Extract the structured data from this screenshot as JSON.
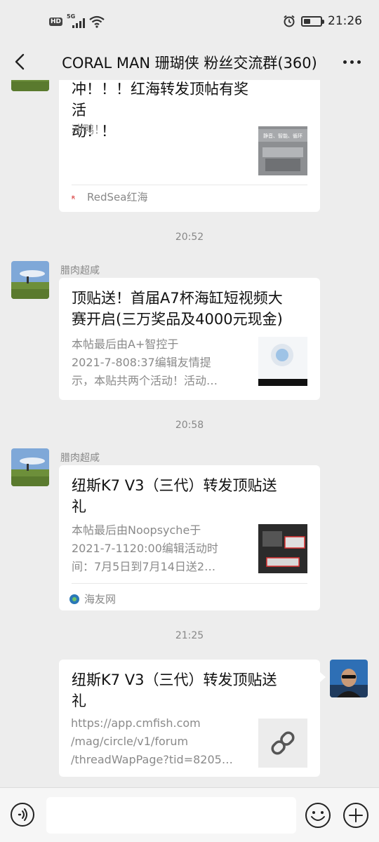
{
  "status_bar": {
    "hd": "HD",
    "network": "5G",
    "time": "21:26"
  },
  "nav": {
    "title": "CORAL MAN 珊瑚侠 粉丝交流群(360)"
  },
  "messages": [
    {
      "title_lines": [
        "冲！！！红海转发顶帖有奖活",
        "动！！"
      ],
      "desc_lines": [
        "冲鸭！"
      ],
      "thumb_caption": "静音、智能、循环",
      "source": "RedSea红海"
    },
    {
      "time": "20:52",
      "sender": "腊肉超咸",
      "title_lines": [
        "顶贴送！首届A7杯海缸短视频大",
        "赛开启(三万奖品及4000元现金)"
      ],
      "desc_lines": [
        "本帖最后由A+智控于",
        "2021-7-808:37编辑友情提",
        "示，本贴共两个活动！活动…"
      ]
    },
    {
      "time": "20:58",
      "sender": "腊肉超咸",
      "title_lines": [
        "纽斯K7 V3（三代）转发顶贴送",
        "礼"
      ],
      "desc_lines": [
        "本帖最后由Noopsyche于",
        "2021-7-1120:00编辑活动时",
        "间：7月5日到7月14日送2…"
      ],
      "source": "海友网"
    },
    {
      "time": "21:25",
      "title_lines": [
        "纽斯K7 V3（三代）转发顶贴送",
        "礼"
      ],
      "desc_lines": [
        "https://app.cmfish.com",
        "/mag/circle/v1/forum",
        "/threadWapPage?tid=8205…"
      ]
    }
  ],
  "input": {
    "placeholder": ""
  },
  "colors": {
    "background": "#ededed",
    "card": "#ffffff",
    "meta_text": "#888888"
  }
}
